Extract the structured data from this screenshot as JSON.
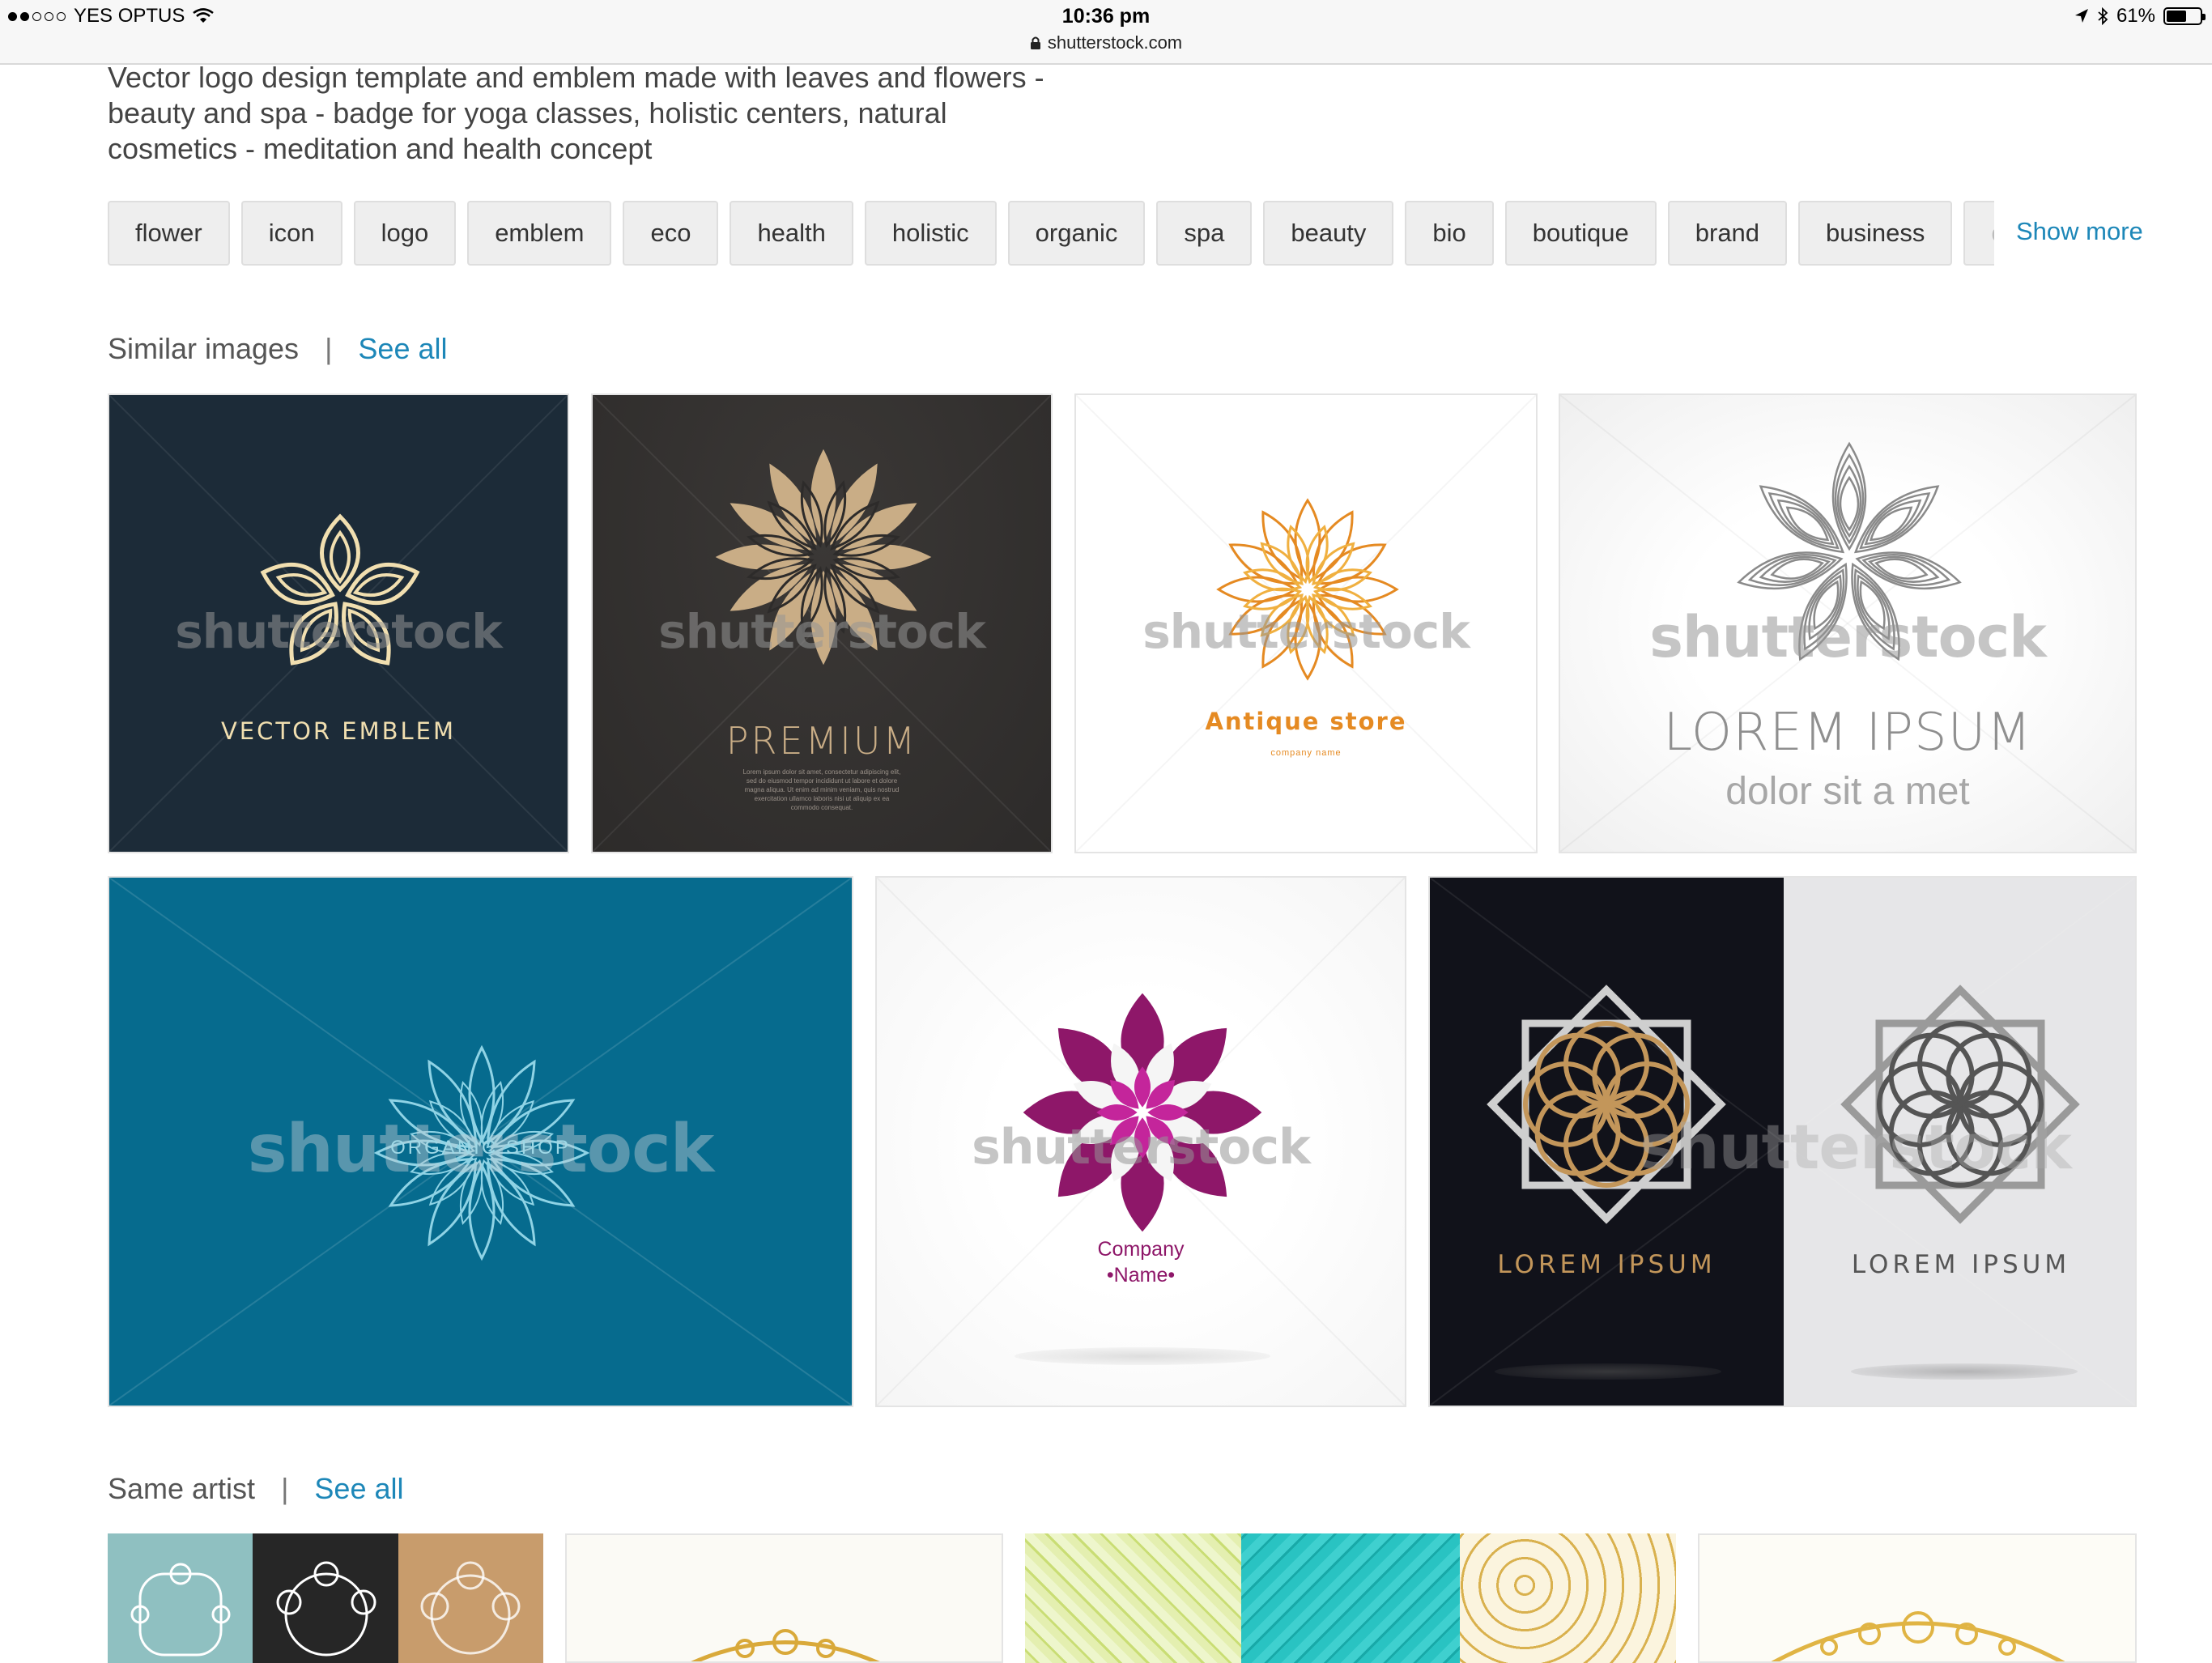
{
  "status": {
    "carrier": "YES OPTUS",
    "time": "10:36 pm",
    "url": "shutterstock.com",
    "battery": "61%",
    "battery_level": 0.61,
    "signal_bars": 2
  },
  "description": "Vector logo design template and emblem made with leaves and flowers - beauty and spa - badge for yoga classes, holistic centers, natural cosmetics - meditation and health concept",
  "keywords": [
    "flower",
    "icon",
    "logo",
    "emblem",
    "eco",
    "health",
    "holistic",
    "organic",
    "spa",
    "beauty",
    "bio",
    "boutique",
    "brand",
    "business",
    "c"
  ],
  "show_more": "Show more",
  "similar": {
    "title": "Similar images",
    "separator": "|",
    "see_all": "See all",
    "watermark": "shutterstock",
    "tiles": [
      {
        "caption": "VECTOR EMBLEM",
        "bg": "#1c2b38",
        "color": "#f1dfb0"
      },
      {
        "caption": "PREMIUM",
        "sub": "Lorem ipsum dolor sit amet, consectetur adipiscing elit, sed do eiusmod tempor incididunt ut labore et dolore magna aliqua. Ut enim ad minim veniam, quis nostrud exercitation ullamco laboris nisi ut aliquip ex ea commodo consequat.",
        "bg": "#2d2b2a",
        "color": "#c9ad86"
      },
      {
        "caption": "Antique store",
        "sub": "company name",
        "bg": "#ffffff",
        "color": "#e58a22"
      },
      {
        "caption": "LOREM IPSUM",
        "sub": "dolor sit a met",
        "bg": "#efefef",
        "color": "#8f8f8f"
      },
      {
        "caption": "ORGANIC SHOP",
        "bg": "#066b8e",
        "color": "#9fd8e6"
      },
      {
        "caption": "Company",
        "sub": "Name",
        "bg": "#f5f5f5",
        "color": "#8e1769"
      },
      {
        "caption": "LOREM IPSUM",
        "caption_b": "LOREM IPSUM",
        "bg": "#11121a",
        "bg_b": "#e6e6e8",
        "color": "#c3965a",
        "color_b": "#555555"
      }
    ]
  },
  "same_artist": {
    "title": "Same artist",
    "separator": "|",
    "see_all": "See all"
  }
}
